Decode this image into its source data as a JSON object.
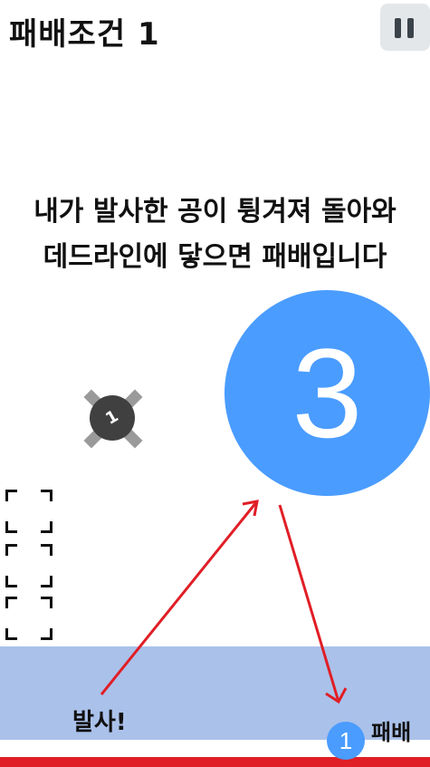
{
  "header": {
    "title": "패배조건 1",
    "pause_icon": "pause-icon"
  },
  "instruction": {
    "line1": "내가 발사한 공이 튕겨져 돌아와",
    "line2": "데드라인에 닿으면 패배입니다"
  },
  "countdown": {
    "value": "3",
    "color": "#4a9cff"
  },
  "target": {
    "label": "1",
    "icon": "x-cross-icon"
  },
  "field": {
    "launch_label": "발사!",
    "defeat_label": "패배",
    "ball_label": "1",
    "launch_zone_color": "#aac1ea",
    "deadline_color": "#e01e26",
    "arrow_color": "#e01e26"
  }
}
